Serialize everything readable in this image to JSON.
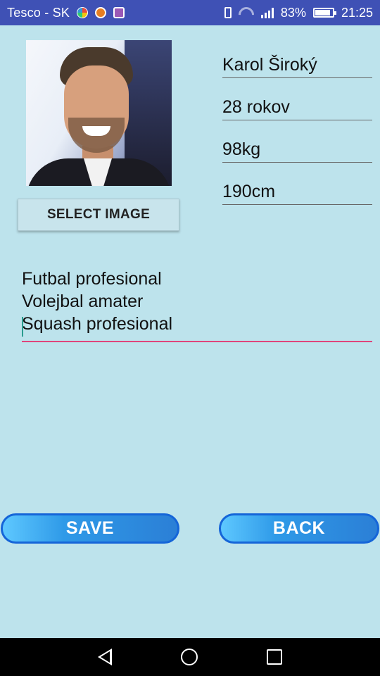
{
  "status_bar": {
    "carrier": "Tesco - SK",
    "battery_percent": "83%",
    "time": "21:25",
    "icons": [
      "app-notification-icon",
      "mail-notification-icon",
      "gallery-notification-icon",
      "vibrate-icon",
      "wifi-icon",
      "signal-icon",
      "battery-icon"
    ]
  },
  "profile": {
    "photo_icon": "profile-photo",
    "select_image_label": "SELECT IMAGE",
    "name": "Karol Široký",
    "age": "28 rokov",
    "weight": "98kg",
    "height": "190cm"
  },
  "hobbies": {
    "lines": [
      "Futbal profesional",
      "Volejbal amater",
      "Squash profesional"
    ]
  },
  "actions": {
    "save_label": "SAVE",
    "back_label": "BACK"
  },
  "navigation": {
    "icons": [
      "nav-back-icon",
      "nav-home-icon",
      "nav-recents-icon"
    ]
  },
  "colors": {
    "background": "#bde3ec",
    "status_bar": "#3f51b5",
    "accent_underline": "#e0457b",
    "button_border": "#1565d8"
  }
}
